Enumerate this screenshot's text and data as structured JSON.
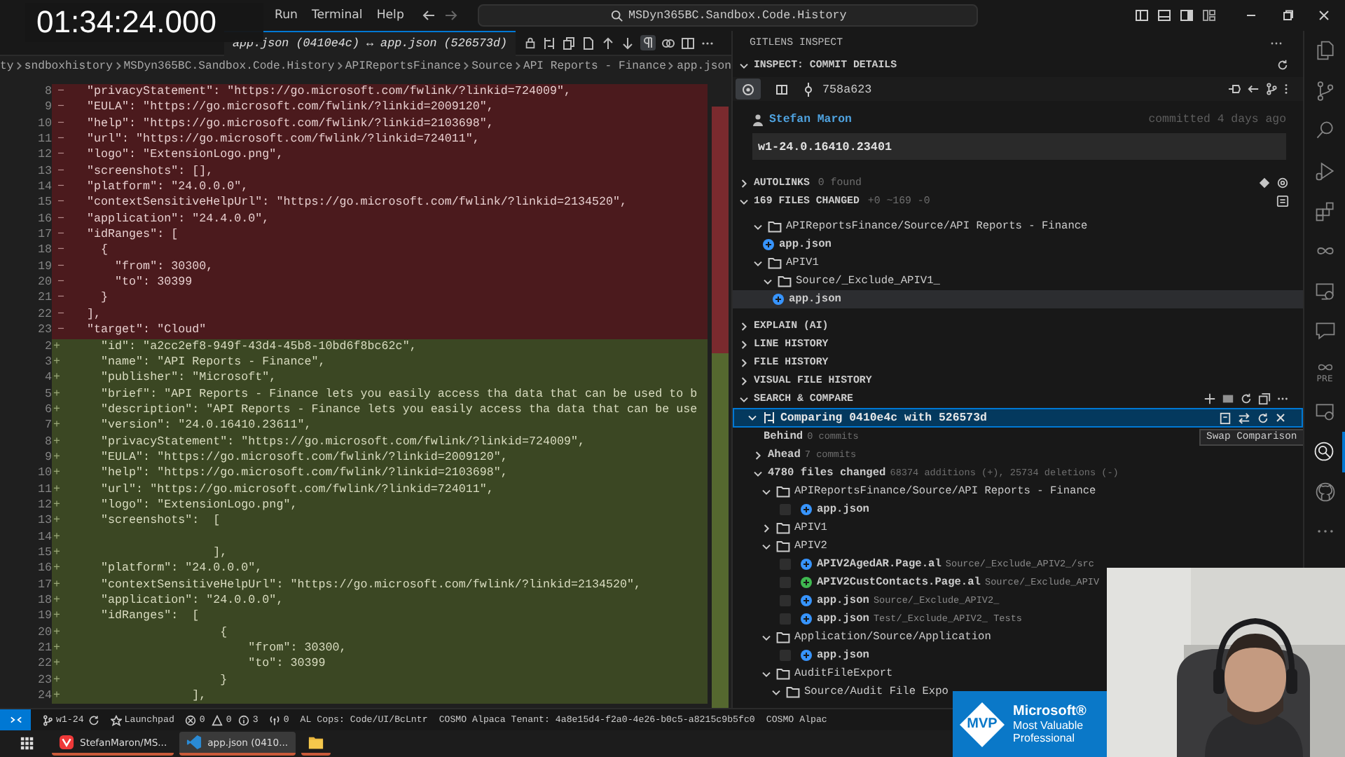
{
  "timestamp": "01:34:24.000",
  "menu": [
    "Run",
    "Terminal",
    "Help"
  ],
  "command_center": "MSDyn365BC.Sandbox.Code.History",
  "editor_tab": {
    "title": "app.json (0410e4c) ↔ app.json (526573d)"
  },
  "breadcrumbs": [
    "ty",
    "sndboxhistory",
    "MSDyn365BC.Sandbox.Code.History",
    "APIReportsFinance",
    "Source",
    "API Reports - Finance",
    "app.json"
  ],
  "diff_lines": [
    {
      "kind": "removed",
      "number": "8",
      "sign": "−",
      "code": "\"privacyStatement\": \"https://go.microsoft.com/fwlink/?linkid=724009\","
    },
    {
      "kind": "removed",
      "number": "9",
      "sign": "−",
      "code": "\"EULA\": \"https://go.microsoft.com/fwlink/?linkid=2009120\","
    },
    {
      "kind": "removed",
      "number": "10",
      "sign": "−",
      "code": "\"help\": \"https://go.microsoft.com/fwlink/?linkid=2103698\","
    },
    {
      "kind": "removed",
      "number": "11",
      "sign": "−",
      "code": "\"url\": \"https://go.microsoft.com/fwlink/?linkid=724011\","
    },
    {
      "kind": "removed",
      "number": "12",
      "sign": "−",
      "code": "\"logo\": \"ExtensionLogo.png\","
    },
    {
      "kind": "removed",
      "number": "13",
      "sign": "−",
      "code": "\"screenshots\": [],"
    },
    {
      "kind": "removed",
      "number": "14",
      "sign": "−",
      "code": "\"platform\": \"24.0.0.0\","
    },
    {
      "kind": "removed",
      "number": "15",
      "sign": "−",
      "code": "\"contextSensitiveHelpUrl\": \"https://go.microsoft.com/fwlink/?linkid=2134520\","
    },
    {
      "kind": "removed",
      "number": "16",
      "sign": "−",
      "code": "\"application\": \"24.4.0.0\","
    },
    {
      "kind": "removed",
      "number": "17",
      "sign": "−",
      "code": "\"idRanges\": ["
    },
    {
      "kind": "removed",
      "number": "18",
      "sign": "−",
      "code": "  {"
    },
    {
      "kind": "removed",
      "number": "19",
      "sign": "−",
      "code": "    \"from\": 30300,"
    },
    {
      "kind": "removed",
      "number": "20",
      "sign": "−",
      "code": "    \"to\": 30399"
    },
    {
      "kind": "removed",
      "number": "21",
      "sign": "−",
      "code": "  }"
    },
    {
      "kind": "removed",
      "number": "22",
      "sign": "−",
      "code": "],"
    },
    {
      "kind": "removed",
      "number": "23",
      "sign": "−",
      "code": "\"target\": \"Cloud\""
    },
    {
      "kind": "added",
      "number": "2",
      "sign": "+",
      "code": "  \"id\": \"a2cc2ef8-949f-43d4-45b8-10bd6f8bc62c\","
    },
    {
      "kind": "added",
      "number": "3",
      "sign": "+",
      "code": "  \"name\": \"API Reports - Finance\","
    },
    {
      "kind": "added",
      "number": "4",
      "sign": "+",
      "code": "  \"publisher\": \"Microsoft\","
    },
    {
      "kind": "added",
      "number": "5",
      "sign": "+",
      "code": "  \"brief\": \"API Reports - Finance lets you easily access tha data that can be used to b"
    },
    {
      "kind": "added",
      "number": "6",
      "sign": "+",
      "code": "  \"description\": \"API Reports - Finance lets you easily access tha data that can be use"
    },
    {
      "kind": "added",
      "number": "7",
      "sign": "+",
      "code": "  \"version\": \"24.0.16410.23611\","
    },
    {
      "kind": "added",
      "number": "8",
      "sign": "+",
      "code": "  \"privacyStatement\": \"https://go.microsoft.com/fwlink/?linkid=724009\","
    },
    {
      "kind": "added",
      "number": "9",
      "sign": "+",
      "code": "  \"EULA\": \"https://go.microsoft.com/fwlink/?linkid=2009120\","
    },
    {
      "kind": "added",
      "number": "10",
      "sign": "+",
      "code": "  \"help\": \"https://go.microsoft.com/fwlink/?linkid=2103698\","
    },
    {
      "kind": "added",
      "number": "11",
      "sign": "+",
      "code": "  \"url\": \"https://go.microsoft.com/fwlink/?linkid=724011\","
    },
    {
      "kind": "added",
      "number": "12",
      "sign": "+",
      "code": "  \"logo\": \"ExtensionLogo.png\","
    },
    {
      "kind": "added",
      "number": "13",
      "sign": "+",
      "code": "  \"screenshots\":  ["
    },
    {
      "kind": "added",
      "number": "14",
      "sign": "+"
    },
    {
      "kind": "added",
      "number": "15",
      "sign": "+",
      "code": "                  ],"
    },
    {
      "kind": "added",
      "number": "16",
      "sign": "+",
      "code": "  \"platform\": \"24.0.0.0\","
    },
    {
      "kind": "added",
      "number": "17",
      "sign": "+",
      "code": "  \"contextSensitiveHelpUrl\": \"https://go.microsoft.com/fwlink/?linkid=2134520\","
    },
    {
      "kind": "added",
      "number": "18",
      "sign": "+",
      "code": "  \"application\": \"24.0.0.0\","
    },
    {
      "kind": "added",
      "number": "19",
      "sign": "+",
      "code": "  \"idRanges\":  ["
    },
    {
      "kind": "added",
      "number": "20",
      "sign": "+",
      "code": "                   {"
    },
    {
      "kind": "added",
      "number": "21",
      "sign": "+",
      "code": "                       \"from\": 30300,"
    },
    {
      "kind": "added",
      "number": "22",
      "sign": "+",
      "code": "                       \"to\": 30399"
    },
    {
      "kind": "added",
      "number": "23",
      "sign": "+",
      "code": "                   }"
    },
    {
      "kind": "added",
      "number": "24",
      "sign": "+",
      "code": "               ],"
    }
  ],
  "gitlens": {
    "title": "GITLENS INSPECT",
    "commit_details": {
      "title": "INSPECT: COMMIT DETAILS",
      "expanded": true,
      "modes": [
        {
          "kind": "commit",
          "selected": true
        },
        {
          "kind": "wip",
          "selected": false
        }
      ],
      "sha": "758a623",
      "author": "Stefan Maron",
      "date": "committed 4 days ago",
      "message": "w1-24.0.16410.23401"
    },
    "autolinks": {
      "title": "AUTOLINKS",
      "note": "0 found",
      "expanded": false
    },
    "files_changed": {
      "title": "169 FILES CHANGED",
      "stats": "+0 ~169 -0",
      "expanded": true,
      "tree": [
        {
          "kind": "folder",
          "label": "APIReportsFinance/Source/API Reports - Finance",
          "expanded": true,
          "selected": false,
          "children": [
            {
              "kind": "file",
              "label": "app.json",
              "color": "#3794ff",
              "selected": false
            }
          ]
        },
        {
          "kind": "folder",
          "label": "APIV1",
          "expanded": true,
          "selected": false,
          "children": [
            {
              "kind": "folder",
              "label": "Source/_Exclude_APIV1_",
              "expanded": true,
              "selected": false,
              "children": [
                {
                  "kind": "file",
                  "label": "app.json",
                  "color": "#3794ff",
                  "selected": true
                }
              ]
            }
          ]
        }
      ]
    },
    "views": [
      {
        "title": "EXPLAIN (AI)",
        "expanded": false
      },
      {
        "title": "LINE HISTORY",
        "expanded": false
      },
      {
        "title": "FILE HISTORY",
        "expanded": false
      },
      {
        "title": "VISUAL FILE HISTORY",
        "expanded": false
      }
    ],
    "search_compare": {
      "title": "SEARCH & COMPARE",
      "expanded": true,
      "comparison": {
        "label": "Comparing 0410e4c with 526573d",
        "selected": true,
        "expanded": true
      },
      "tooltip": "Swap Comparison",
      "rows": [
        {
          "label": "Behind",
          "detail": "0 commits"
        },
        {
          "label": "Ahead",
          "detail": "7 commits",
          "expanded": false
        },
        {
          "label": "4780 files changed",
          "detail": "68374 additions (+), 25734 deletions (-)",
          "expanded": true
        }
      ],
      "tree": [
        {
          "kind": "folder",
          "label": "APIReportsFinance/Source/API Reports - Finance",
          "expanded": true,
          "children": [
            {
              "kind": "file",
              "label": "app.json",
              "color": "#3794ff",
              "checked": false
            }
          ]
        },
        {
          "kind": "folder",
          "label": "APIV1",
          "expanded": false
        },
        {
          "kind": "folder",
          "label": "APIV2",
          "expanded": true,
          "children": [
            {
              "kind": "file",
              "label": "APIV2AgedAR.Page.al",
              "path": "Source/_Exclude_APIV2_/src",
              "color": "#3794ff",
              "checked": false
            },
            {
              "kind": "file",
              "label": "APIV2CustContacts.Page.al",
              "path": "Source/_Exclude_APIV",
              "color": "#3fb950",
              "checked": false
            },
            {
              "kind": "file",
              "label": "app.json",
              "path": "Source/_Exclude_APIV2_",
              "color": "#3794ff",
              "checked": false
            },
            {
              "kind": "file",
              "label": "app.json",
              "path": "Test/_Exclude_APIV2_ Tests",
              "color": "#3794ff",
              "checked": false
            }
          ]
        },
        {
          "kind": "folder",
          "label": "Application/Source/Application",
          "expanded": true,
          "children": [
            {
              "kind": "file",
              "label": "app.json",
              "color": "#3794ff",
              "checked": false
            }
          ]
        },
        {
          "kind": "folder",
          "label": "AuditFileExport",
          "expanded": true,
          "children": [
            {
              "kind": "folder",
              "label": "Source/Audit File Expo",
              "expanded": true
            }
          ]
        }
      ]
    }
  },
  "activity_bar": [
    {
      "kind": "files",
      "selected": false
    },
    {
      "kind": "source-control",
      "selected": false
    },
    {
      "kind": "search",
      "selected": false
    },
    {
      "kind": "run",
      "selected": false
    },
    {
      "kind": "extensions",
      "selected": false
    },
    {
      "kind": "gitlens",
      "selected": false
    },
    {
      "kind": "remote",
      "selected": false
    },
    {
      "kind": "chat",
      "selected": false
    },
    {
      "kind": "pre",
      "label": "PRE",
      "selected": false
    },
    {
      "kind": "remote2",
      "selected": false
    },
    {
      "kind": "inspect",
      "selected": true
    },
    {
      "kind": "github",
      "selected": false
    },
    {
      "kind": "more",
      "selected": false
    }
  ],
  "status_bar": [
    {
      "kind": "remote"
    },
    {
      "kind": "branch",
      "text": "w1-24"
    },
    {
      "kind": "sync"
    },
    {
      "kind": "launchpad",
      "text": "Launchpad"
    },
    {
      "kind": "problems",
      "errors": "0",
      "warnings": "0",
      "infos": "3"
    },
    {
      "kind": "ports",
      "text": "0"
    },
    {
      "kind": "text",
      "text": "AL Cops: Code/UI/BcLntr"
    },
    {
      "kind": "text",
      "text": "COSMO Alpaca Tenant: 4a8e15d4-f2a0-4e26-b0c5-a8215c9b5fc0"
    },
    {
      "kind": "text",
      "text": "COSMO Alpac"
    }
  ],
  "taskbar": [
    {
      "kind": "start"
    },
    {
      "kind": "browser",
      "text": "StefanMaron/MS...",
      "selected": false
    },
    {
      "kind": "editor",
      "text": "app.json (0410...",
      "selected": true
    },
    {
      "kind": "folder",
      "selected": false
    }
  ],
  "mvp_badge": {
    "mark": "MVP",
    "lines": [
      "Microsoft®",
      "Most Valuable",
      "Professional"
    ]
  },
  "webcam": {
    "kind": "picture"
  }
}
